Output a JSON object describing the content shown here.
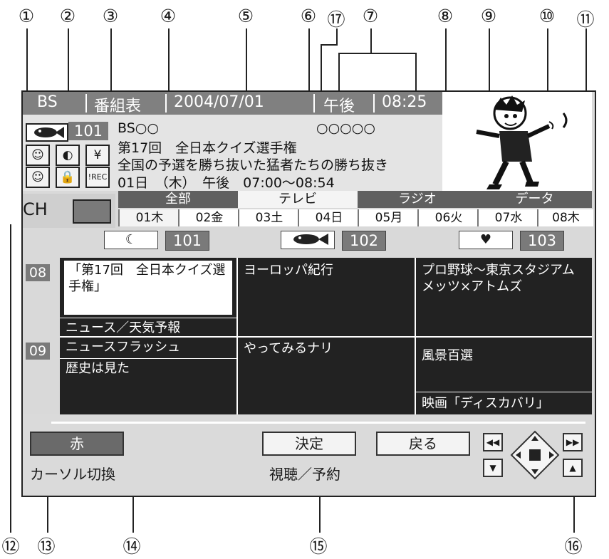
{
  "callouts": [
    "①",
    "②",
    "③",
    "④",
    "⑤",
    "⑥",
    "⑰",
    "⑦",
    "⑧",
    "⑨",
    "⑩",
    "⑪",
    "⑫",
    "⑬",
    "⑭",
    "⑮",
    "⑯"
  ],
  "topbar": {
    "broadcast": "BS",
    "mode": "番組表",
    "date": "2004/07/01",
    "ampm": "午後",
    "time": "08:25"
  },
  "info": {
    "channel_icon": "fish-icon",
    "channel_number": "101",
    "station": "BS○○",
    "genre": "○○○○○",
    "title": "第17回　全日本クイズ選手権",
    "description": "全国の予選を勝ち抜いた猛者たちの勝ち抜き",
    "schedule": "01日　（木）　午後　07:00〜08:54",
    "icons": [
      "☺",
      "◐",
      "¥",
      "☺",
      "🔒",
      "!REC"
    ]
  },
  "picture": {
    "description_icon": "kicking-boy-illustration"
  },
  "tabs": {
    "items": [
      "全部",
      "テレビ",
      "ラジオ",
      "データ"
    ],
    "selected": "テレビ",
    "ch_label": "CH"
  },
  "days": [
    "01木",
    "02金",
    "03土",
    "04日",
    "05月",
    "06火",
    "07水",
    "08木"
  ],
  "channels": [
    {
      "icon": "moon-icon",
      "number": "101"
    },
    {
      "icon": "fish-icon",
      "number": "102"
    },
    {
      "icon": "heart-icon",
      "number": "103"
    }
  ],
  "hours": [
    "08",
    "09"
  ],
  "programs": {
    "c1_a": "「第17回　全日本クイズ選手権」",
    "c1_b": "ニュース／天気予報",
    "c1_c": "ニュースフラッシュ",
    "c1_d": "歴史は見た",
    "c2_a": "ヨーロッパ紀行",
    "c2_b": "やってみるナリ",
    "c3_a": "プロ野球〜東京スタジアム　メッツ×アトムズ",
    "c3_b": "風景百選",
    "c3_c": "映画「ディスカバリ」"
  },
  "buttons": {
    "red": "赤",
    "red_caption": "カーソル切換",
    "enter": "決定",
    "enter_caption": "視聴／予約",
    "back": "戻る"
  }
}
